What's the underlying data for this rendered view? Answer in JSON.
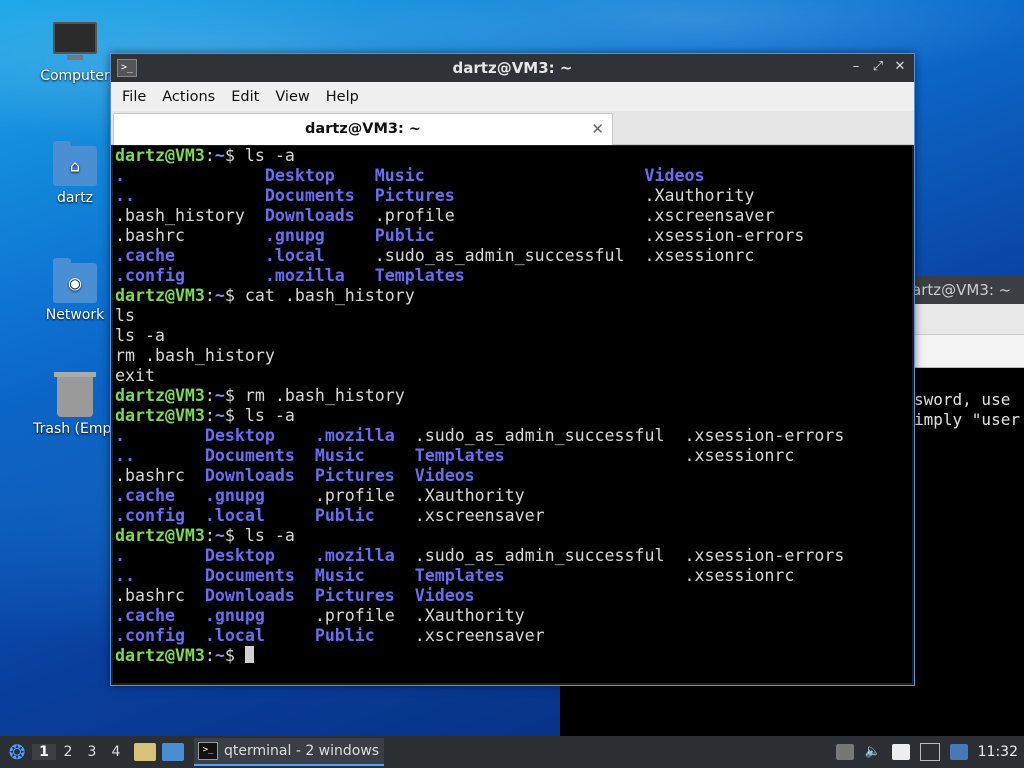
{
  "desktop": {
    "icons": [
      {
        "label": "Computer"
      },
      {
        "label": "dartz"
      },
      {
        "label": "Network"
      },
      {
        "label": "Trash (Empt"
      }
    ]
  },
  "bg_window": {
    "title": "artz@VM3: ~",
    "lines": [
      "sword, use",
      "imply \"user"
    ]
  },
  "window": {
    "title": "dartz@VM3: ~",
    "menu": [
      "File",
      "Actions",
      "Edit",
      "View",
      "Help"
    ],
    "tab_label": "dartz@VM3: ~",
    "prompt_user": "dartz@VM3",
    "prompt_path": "~",
    "prompt_sym": "$",
    "terminal": {
      "cmd1": "ls -a",
      "ls1": [
        [
          ".",
          "Desktop",
          "Music",
          "Videos"
        ],
        [
          "..",
          "Documents",
          "Pictures",
          ".Xauthority"
        ],
        [
          ".bash_history",
          "Downloads",
          ".profile",
          ".xscreensaver"
        ],
        [
          ".bashrc",
          ".gnupg",
          "Public",
          ".xsession-errors"
        ],
        [
          ".cache",
          ".local",
          ".sudo_as_admin_successful",
          ".xsessionrc"
        ],
        [
          ".config",
          ".mozilla",
          "Templates",
          ""
        ]
      ],
      "cmd2": "cat .bash_history",
      "history": [
        "ls",
        "ls -a",
        "rm .bash_history",
        "exit"
      ],
      "cmd3": "rm .bash_history",
      "cmd4": "ls -a",
      "ls2": [
        [
          ".",
          "Desktop",
          ".mozilla",
          ".sudo_as_admin_successful",
          ".xsession-errors"
        ],
        [
          "..",
          "Documents",
          "Music",
          "Templates",
          ".xsessionrc"
        ],
        [
          ".bashrc",
          "Downloads",
          "Pictures",
          "Videos",
          ""
        ],
        [
          ".cache",
          ".gnupg",
          ".profile",
          ".Xauthority",
          ""
        ],
        [
          ".config",
          ".local",
          "Public",
          ".xscreensaver",
          ""
        ]
      ],
      "cmd5": "ls -a"
    }
  },
  "taskbar": {
    "workspaces": [
      "1",
      "2",
      "3",
      "4"
    ],
    "task_label": "qterminal - 2 windows",
    "clock": "11:32"
  }
}
